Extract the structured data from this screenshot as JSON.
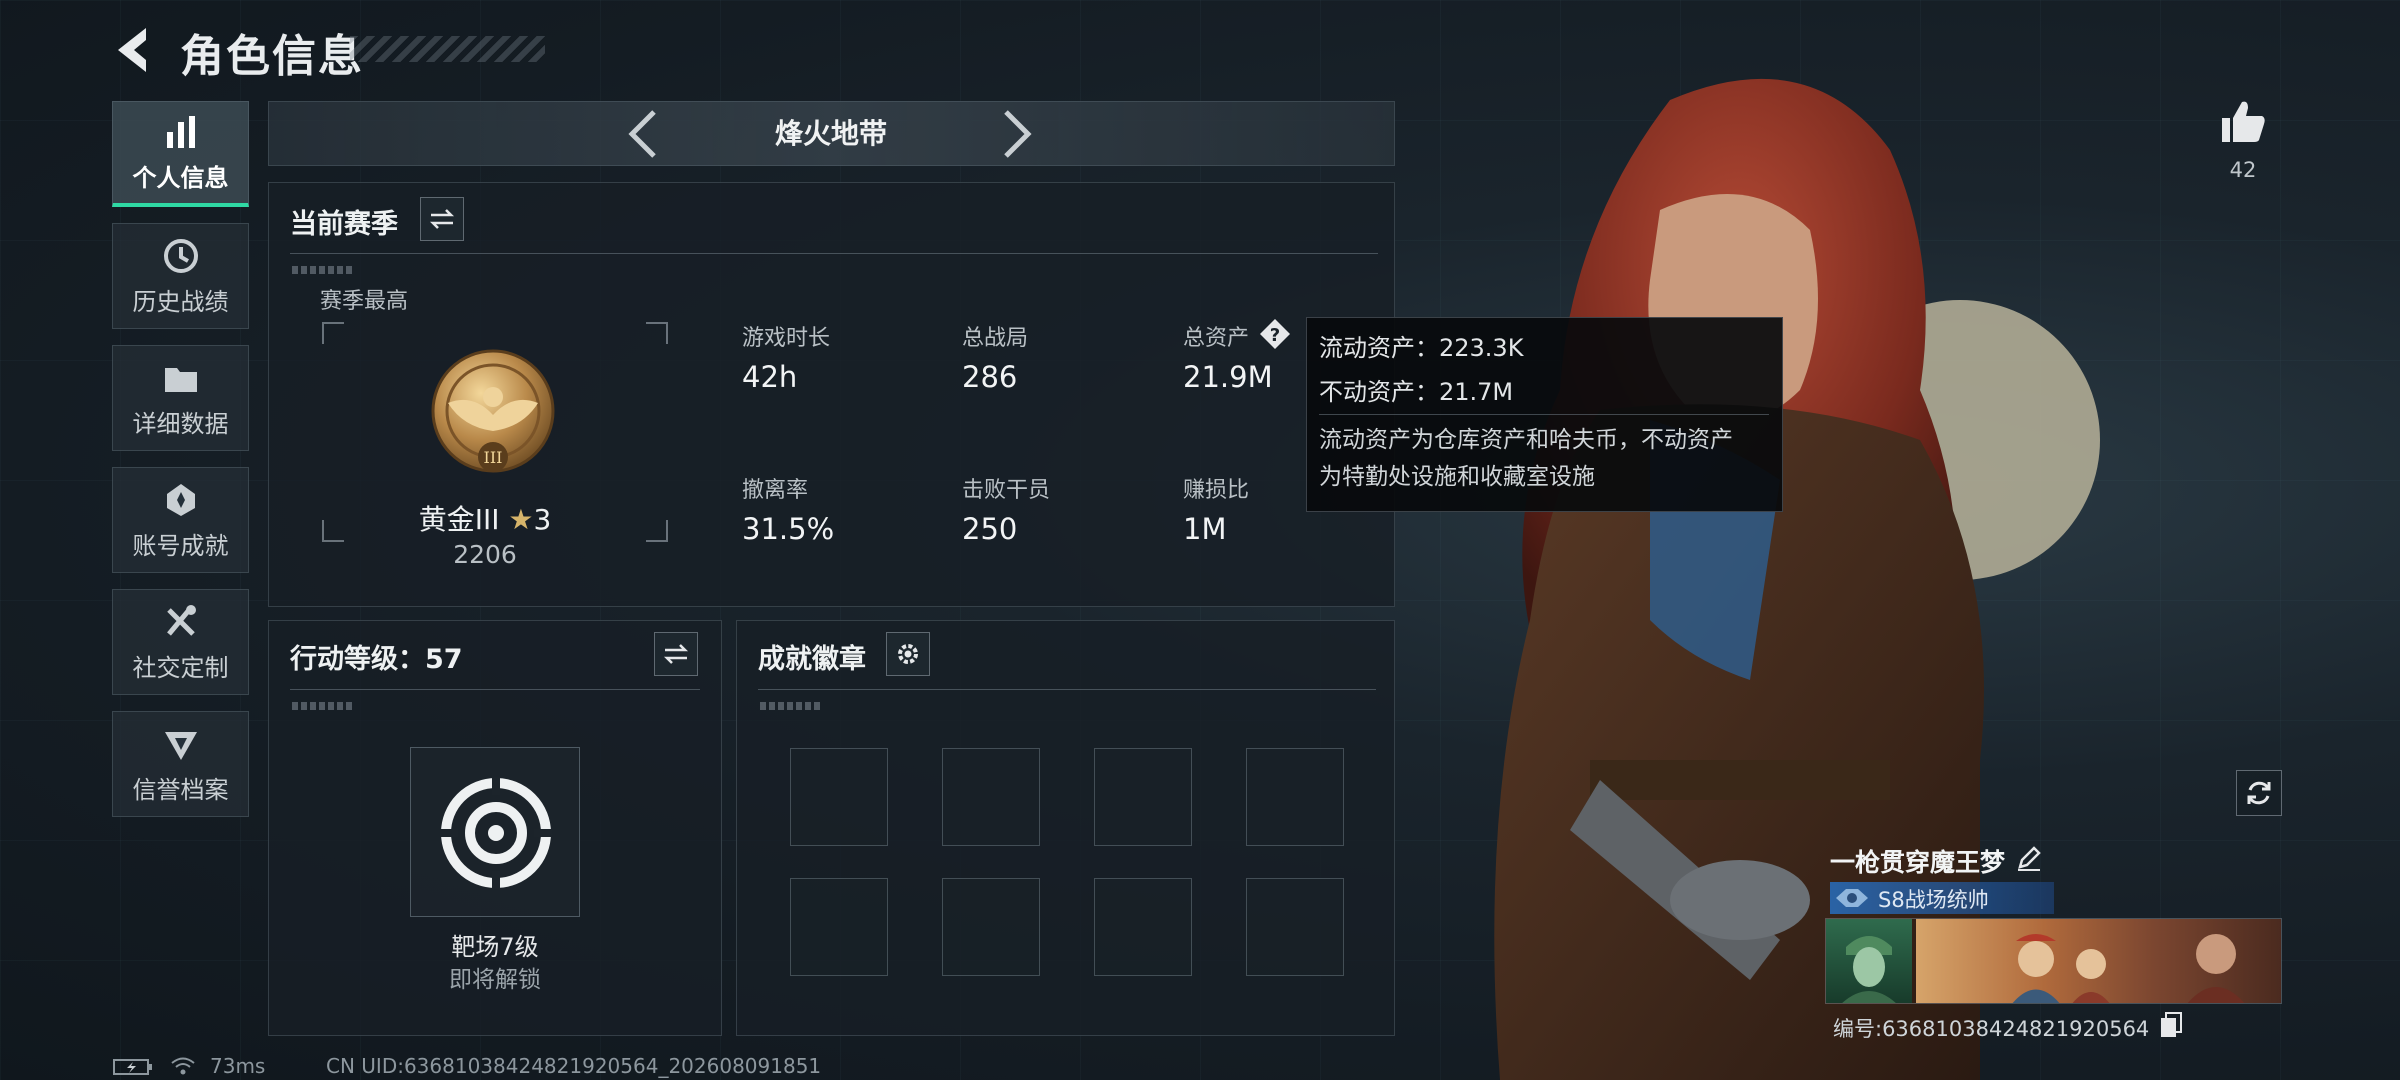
{
  "header": {
    "title": "角色信息"
  },
  "sidebar": {
    "items": [
      {
        "label": "个人信息",
        "icon": "bar-chart-icon",
        "active": true
      },
      {
        "label": "历史战绩",
        "icon": "history-clock-icon",
        "active": false
      },
      {
        "label": "详细数据",
        "icon": "folder-icon",
        "active": false
      },
      {
        "label": "账号成就",
        "icon": "achievement-medal-icon",
        "active": false
      },
      {
        "label": "社交定制",
        "icon": "tools-icon",
        "active": false
      },
      {
        "label": "信誉档案",
        "icon": "shield-badge-icon",
        "active": false
      }
    ]
  },
  "mode": {
    "title": "烽火地带"
  },
  "season": {
    "heading": "当前赛季",
    "best_label": "赛季最高",
    "rank_name": "黄金III",
    "rank_stars": "3",
    "rank_score": "2206",
    "stats": [
      {
        "label": "游戏时长",
        "value": "42h"
      },
      {
        "label": "总战局",
        "value": "286"
      },
      {
        "label": "总资产",
        "value": "21.9M"
      },
      {
        "label": "撤离率",
        "value": "31.5%"
      },
      {
        "label": "击败干员",
        "value": "250"
      },
      {
        "label": "赚损比",
        "value": "1M"
      }
    ]
  },
  "tooltip": {
    "liquid": "流动资产：223.3K",
    "fixed": "不动资产：21.7M",
    "desc_line1": "流动资产为仓库资产和哈夫币，不动资产",
    "desc_line2": "为特勤处设施和收藏室设施"
  },
  "action": {
    "heading": "行动等级：57",
    "item_name": "靶场7级",
    "item_status": "即将解锁"
  },
  "badges": {
    "heading": "成就徽章",
    "slots": 8
  },
  "status": {
    "ping": "73ms",
    "uid": "CN UID:6368103842482192056­4_202608091851"
  },
  "player": {
    "likes": "42",
    "name": "一枪贯穿魔王梦",
    "rank_title": "S8战场统帅",
    "id_line": "编号:6368103842482192056­4"
  },
  "colors": {
    "accent": "#2fd9a4",
    "rank_blue": "#2b6ebf"
  }
}
